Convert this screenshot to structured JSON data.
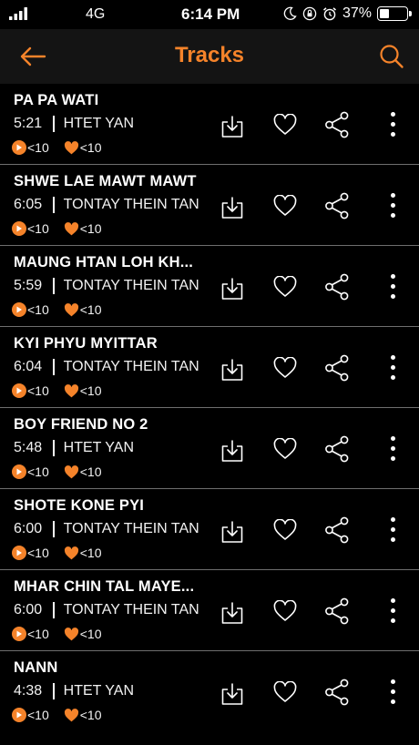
{
  "status_bar": {
    "carrier": "4G",
    "time": "6:14 PM",
    "battery_percent": "37%",
    "battery_level": 0.37,
    "icons": [
      "signal-icon",
      "moon-icon",
      "orientation-lock-icon",
      "alarm-icon",
      "battery-icon"
    ]
  },
  "header": {
    "title": "Tracks",
    "back_icon": "back-arrow-icon",
    "search_icon": "search-icon"
  },
  "colors": {
    "accent": "#f5832a",
    "background": "#000000",
    "header_background": "#141414",
    "divider": "#6e6e6e"
  },
  "tracks": [
    {
      "title": "PA PA WATI",
      "duration": "5:21",
      "artist": "HTET YAN",
      "plays": "<10",
      "likes": "<10"
    },
    {
      "title": "SHWE LAE MAWT MAWT",
      "duration": "6:05",
      "artist": "TONTAY THEIN TAN",
      "plays": "<10",
      "likes": "<10"
    },
    {
      "title": "MAUNG HTAN LOH KH...",
      "duration": "5:59",
      "artist": "TONTAY THEIN TAN",
      "plays": "<10",
      "likes": "<10"
    },
    {
      "title": "KYI PHYU MYITTAR",
      "duration": "6:04",
      "artist": "TONTAY THEIN TAN",
      "plays": "<10",
      "likes": "<10"
    },
    {
      "title": "BOY FRIEND NO 2",
      "duration": "5:48",
      "artist": "HTET YAN",
      "plays": "<10",
      "likes": "<10"
    },
    {
      "title": "SHOTE KONE PYI",
      "duration": "6:00",
      "artist": "TONTAY THEIN TAN",
      "plays": "<10",
      "likes": "<10"
    },
    {
      "title": "MHAR CHIN TAL MAYE...",
      "duration": "6:00",
      "artist": "TONTAY THEIN TAN",
      "plays": "<10",
      "likes": "<10"
    },
    {
      "title": "NANN",
      "duration": "4:38",
      "artist": "HTET YAN",
      "plays": "<10",
      "likes": "<10"
    }
  ],
  "row_actions": [
    "download-icon",
    "heart-icon",
    "share-icon",
    "more-vertical-icon"
  ]
}
